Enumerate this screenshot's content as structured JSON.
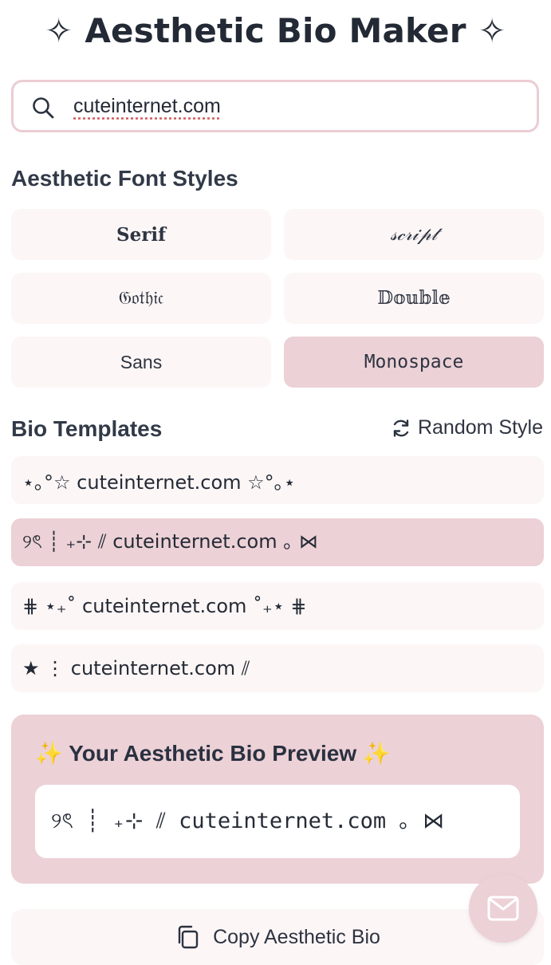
{
  "header": {
    "title": "✧ Aesthetic Bio Maker ✧"
  },
  "search": {
    "value": "cuteinternet.com"
  },
  "fonts": {
    "heading": "Aesthetic Font Styles",
    "items": [
      {
        "label": "Serif"
      },
      {
        "label": "𝓈𝒸𝓇𝒾𝓅𝓉"
      },
      {
        "label": "𝔊𝔬𝔱𝔥𝔦𝔠"
      },
      {
        "label": "𝔻𝕠𝕦𝕓𝕝𝕖"
      },
      {
        "label": "Sans"
      },
      {
        "label": "Monospace"
      }
    ],
    "selected": "Monospace"
  },
  "templates": {
    "heading": "Bio Templates",
    "random_label": "Random Style",
    "items": [
      {
        "text": "⋆｡°☆ cuteinternet.com ☆°｡⋆"
      },
      {
        "text": "୨ৎ ┊ ₊⊹ ⫽ cuteinternet.com ｡ ⋈"
      },
      {
        "text": "⋕ ⋆₊˚ cuteinternet.com ˚₊⋆ ⋕"
      },
      {
        "text": "★ ⋮ cuteinternet.com ⫽"
      }
    ],
    "selected_index": 1
  },
  "preview": {
    "title": "✨ Your Aesthetic Bio Preview ✨",
    "text": "୨ৎ ┊ ₊⊹ ⫽ cuteinternet.com ｡ ⋈"
  },
  "copy": {
    "label": "Copy Aesthetic Bio"
  },
  "colors": {
    "accent": "#ecd1d6",
    "tile": "#fcf6f6",
    "text": "#2b3240"
  }
}
